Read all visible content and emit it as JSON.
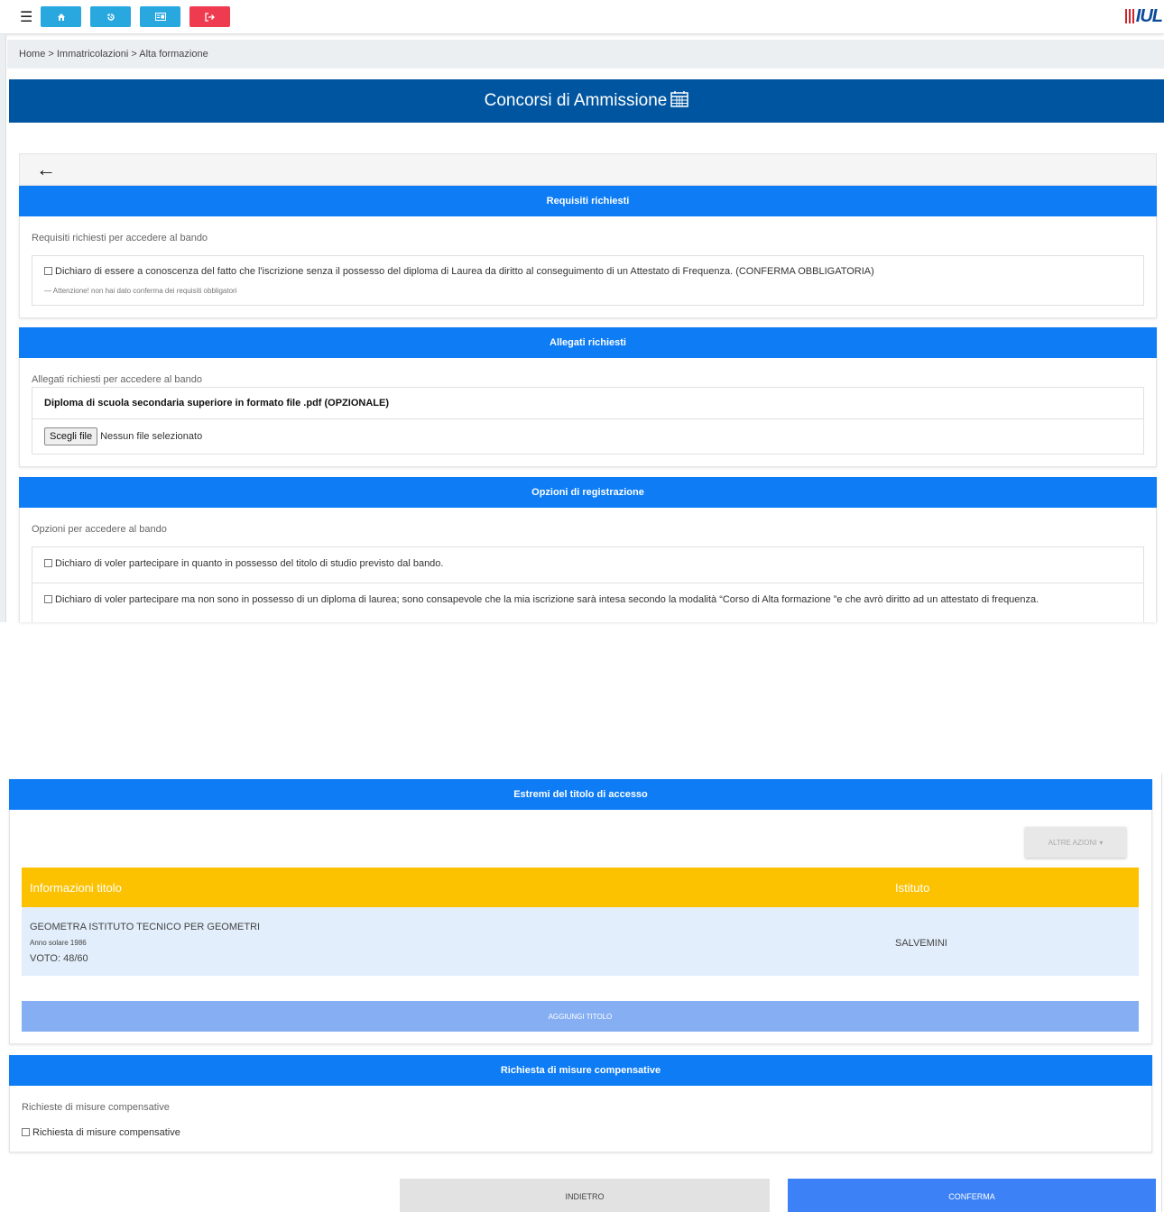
{
  "topbar": {
    "menu_icon": "hamburger-icon",
    "buttons": [
      {
        "icon": "home-icon",
        "color": "#29a8e0"
      },
      {
        "icon": "history-icon",
        "color": "#29a8e0"
      },
      {
        "icon": "id-card-icon",
        "color": "#29a8e0"
      },
      {
        "icon": "logout-icon",
        "color": "#ef3b4f"
      }
    ],
    "logo_text": "IUL"
  },
  "breadcrumb": "Home > Immatricolazioni > Alta formazione",
  "page_title": "Concorsi di Ammissione",
  "requisiti": {
    "header": "Requisiti richiesti",
    "subtitle": "Requisiti richiesti per accedere al bando",
    "checkbox_label": "Dichiaro di essere a conoscenza del fatto che l'iscrizione senza il possesso del diploma di Laurea da diritto al conseguimento di un Attestato di Frequenza. (CONFERMA OBBLIGATORIA)",
    "warning": "— Attenzione! non hai dato conferma dei requisiti obbligatori"
  },
  "allegati": {
    "header": "Allegati richiesti",
    "subtitle": "Allegati richiesti per accedere al bando",
    "item_title": "Diploma di scuola secondaria superiore in formato file .pdf (OPZIONALE)",
    "file_button": "Scegli file",
    "file_status": "Nessun file selezionato"
  },
  "opzioni": {
    "header": "Opzioni di registrazione",
    "subtitle": "Opzioni per accedere al bando",
    "option1": "Dichiaro di voler partecipare in quanto in possesso del titolo di studio previsto dal bando.",
    "option2": "Dichiaro di voler partecipare ma non sono in possesso di un diploma di laurea; sono consapevole che la mia iscrizione sarà intesa secondo la modalità “Corso di Alta formazione ”e che avrò diritto ad un attestato di frequenza."
  },
  "estremi": {
    "header": "Estremi del titolo di accesso",
    "altre_azioni": "ALTRE AZIONI",
    "col_info": "Informazioni titolo",
    "col_istituto": "Istituto",
    "row": {
      "titolo": "GEOMETRA ISTITUTO TECNICO PER GEOMETRI",
      "anno": "Anno solare 1986",
      "voto": "VOTO: 48/60",
      "istituto": "SALVEMINI"
    },
    "aggiungi": "AGGIUNGI TITOLO"
  },
  "misure": {
    "header": "Richiesta di misure compensative",
    "subtitle": "Richieste di misure compensative",
    "checkbox_label": "Richiesta di misure compensative"
  },
  "footer": {
    "indietro": "INDIETRO",
    "conferma": "CONFERMA"
  },
  "colors": {
    "primary_blue": "#0055a0",
    "section_blue": "#0d7cf5",
    "table_header": "#fcc200",
    "confirm_blue": "#3c82f6"
  }
}
